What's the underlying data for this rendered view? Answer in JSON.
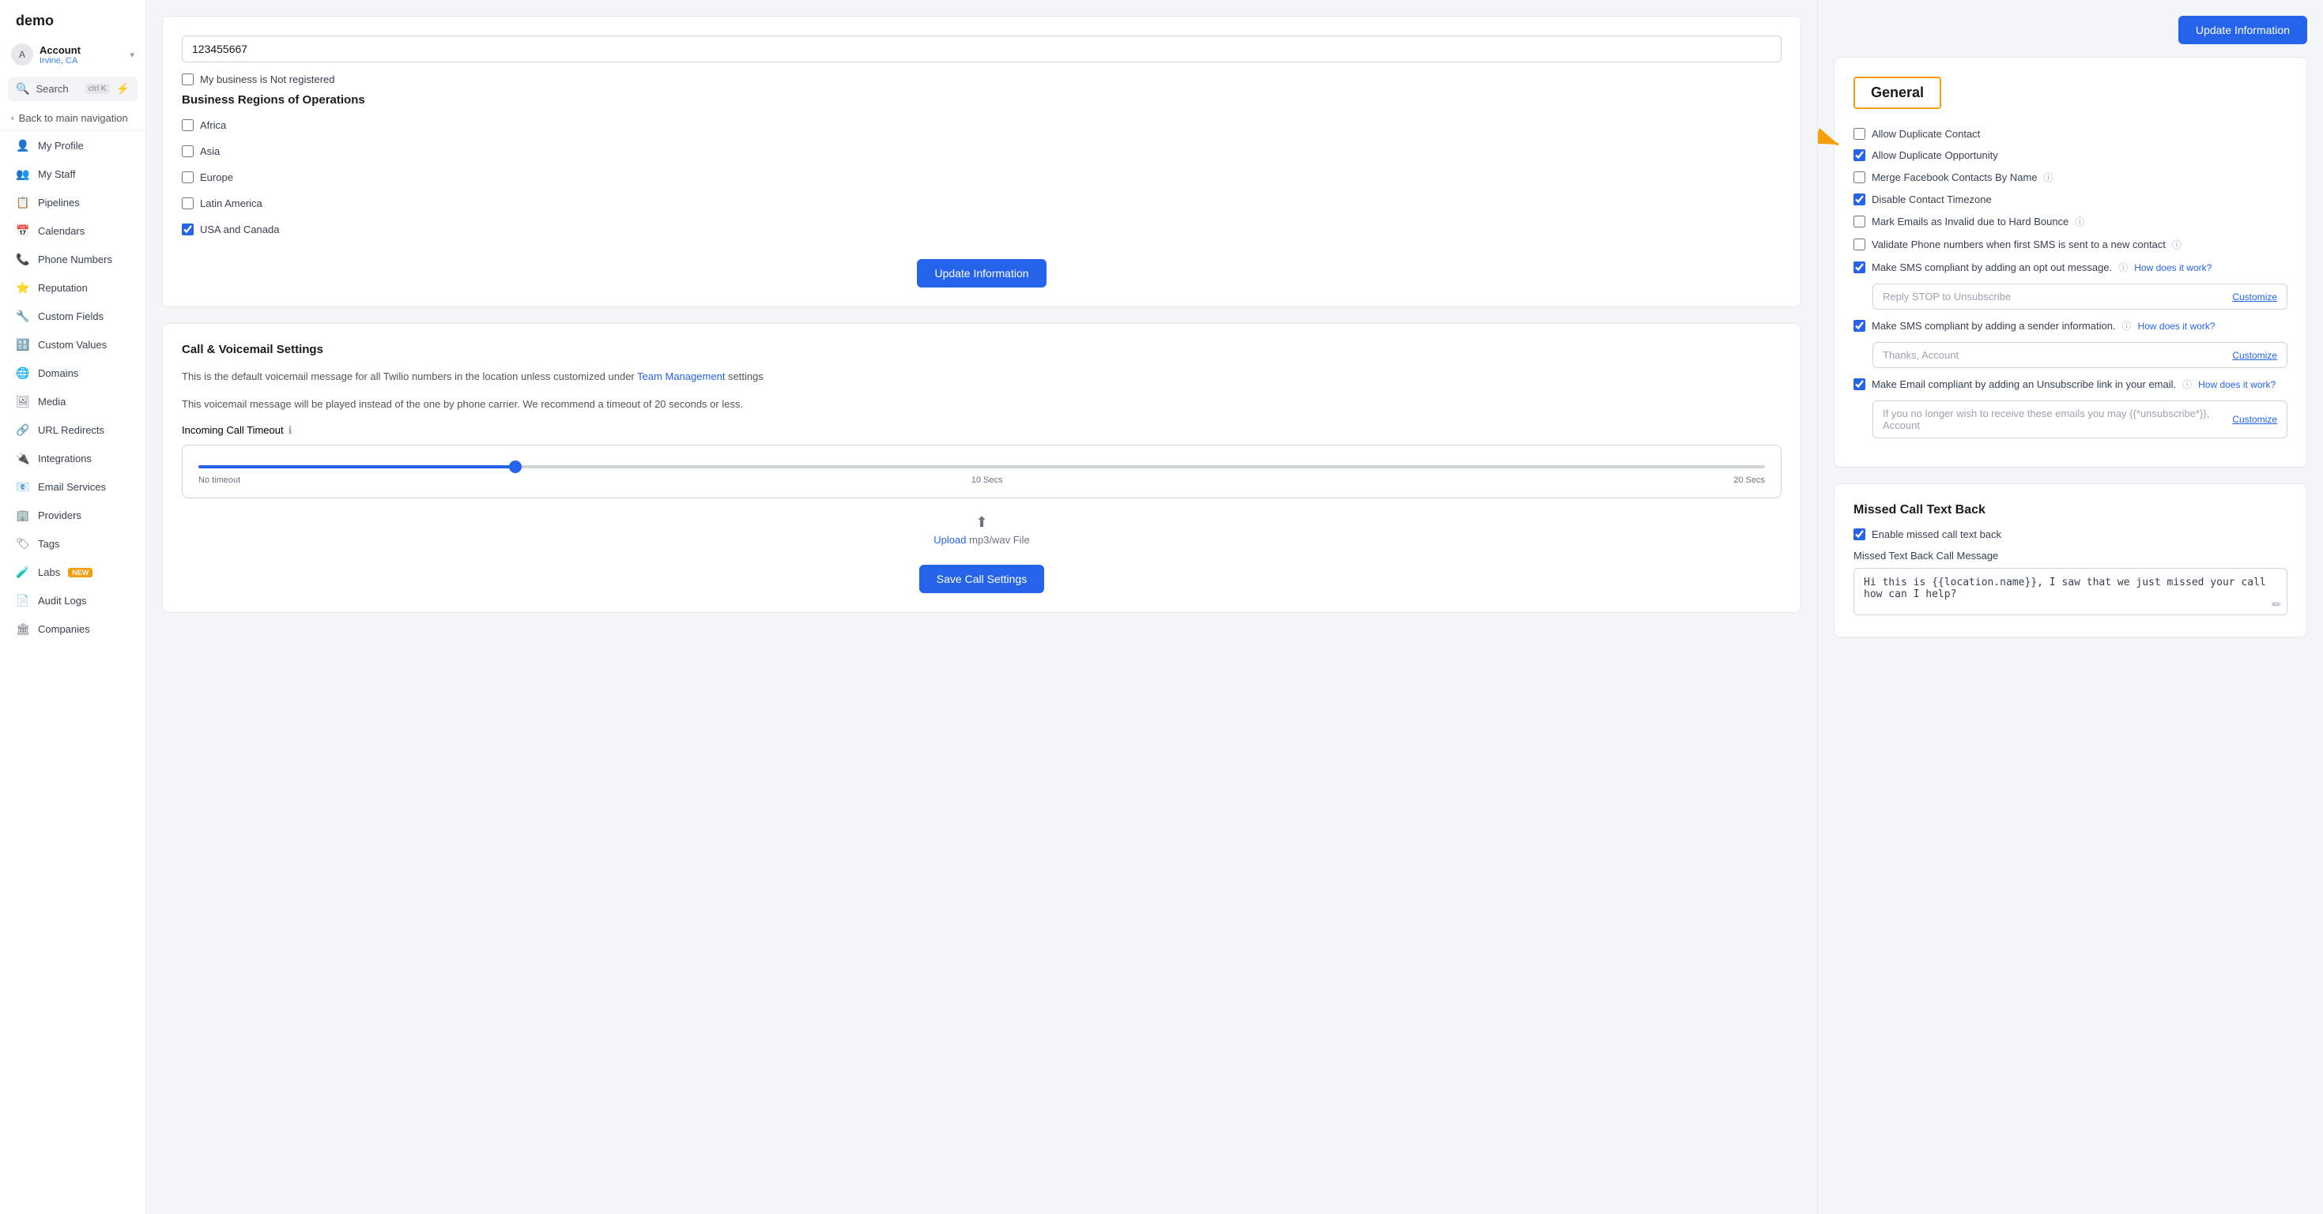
{
  "sidebar": {
    "logo": "demo",
    "account": {
      "name": "Account",
      "location": "Irvine, CA"
    },
    "search": {
      "label": "Search",
      "shortcut": "ctrl K"
    },
    "back_nav": "Back to main navigation",
    "items": [
      {
        "id": "my-profile",
        "label": "My Profile",
        "icon": "👤"
      },
      {
        "id": "my-staff",
        "label": "My Staff",
        "icon": "👥"
      },
      {
        "id": "pipelines",
        "label": "Pipelines",
        "icon": "📋"
      },
      {
        "id": "calendars",
        "label": "Calendars",
        "icon": "📅"
      },
      {
        "id": "phone-numbers",
        "label": "Phone Numbers",
        "icon": "📞"
      },
      {
        "id": "reputation",
        "label": "Reputation",
        "icon": "⭐"
      },
      {
        "id": "custom-fields",
        "label": "Custom Fields",
        "icon": "🔧"
      },
      {
        "id": "custom-values",
        "label": "Custom Values",
        "icon": "🔠"
      },
      {
        "id": "domains",
        "label": "Domains",
        "icon": "🌐"
      },
      {
        "id": "media",
        "label": "Media",
        "icon": "🖼"
      },
      {
        "id": "url-redirects",
        "label": "URL Redirects",
        "icon": "🔗"
      },
      {
        "id": "integrations",
        "label": "Integrations",
        "icon": "🔌"
      },
      {
        "id": "email-services",
        "label": "Email Services",
        "icon": "📧"
      },
      {
        "id": "providers",
        "label": "Providers",
        "icon": "🏢"
      },
      {
        "id": "tags",
        "label": "Tags",
        "icon": "🏷"
      },
      {
        "id": "labs",
        "label": "Labs",
        "icon": "🧪",
        "badge": "new"
      },
      {
        "id": "audit-logs",
        "label": "Audit Logs",
        "icon": "📄"
      },
      {
        "id": "companies",
        "label": "Companies",
        "icon": "🏛"
      }
    ]
  },
  "left_panel": {
    "business_number": "123455667",
    "not_registered_label": "My business is Not registered",
    "regions_title": "Business Regions of Operations",
    "regions": [
      {
        "label": "Africa",
        "checked": false
      },
      {
        "label": "Asia",
        "checked": false
      },
      {
        "label": "Europe",
        "checked": false
      },
      {
        "label": "Latin America",
        "checked": false
      },
      {
        "label": "USA and Canada",
        "checked": true
      }
    ],
    "update_btn": "Update Information",
    "call_voicemail": {
      "title": "Call & Voicemail Settings",
      "desc1": "This is the default voicemail message for all Twilio numbers in the location unless customized under",
      "link_text": "Team Management",
      "desc2": "settings",
      "desc3": "This voicemail message will be played instead of the one by phone carrier. We recommend a timeout of 20 seconds or less.",
      "timeout_label": "Incoming Call Timeout",
      "slider_labels": [
        "No timeout",
        "10 Secs",
        "20 Secs"
      ],
      "upload_label": "Upload mp3/wav File",
      "save_btn": "Save Call Settings"
    }
  },
  "right_panel": {
    "update_btn": "Update Information",
    "general_title": "General",
    "annotation_label": "General",
    "options": [
      {
        "id": "allow-duplicate-contact",
        "label": "Allow Duplicate Contact",
        "checked": false,
        "has_info": false,
        "has_link": false
      },
      {
        "id": "allow-duplicate-opportunity",
        "label": "Allow Duplicate Opportunity",
        "checked": true,
        "has_info": false,
        "has_link": false
      },
      {
        "id": "merge-facebook",
        "label": "Merge Facebook Contacts By Name",
        "checked": false,
        "has_info": true,
        "has_link": false
      },
      {
        "id": "disable-contact-tz",
        "label": "Disable Contact Timezone",
        "checked": true,
        "has_info": false,
        "has_link": false
      },
      {
        "id": "mark-emails-invalid",
        "label": "Mark Emails as Invalid due to Hard Bounce",
        "checked": false,
        "has_info": true,
        "has_link": false
      },
      {
        "id": "validate-phone",
        "label": "Validate Phone numbers when first SMS is sent to a new contact",
        "checked": false,
        "has_info": true,
        "has_link": false
      },
      {
        "id": "sms-compliant-opt-out",
        "label": "Make SMS compliant by adding an opt out message.",
        "checked": true,
        "has_info": true,
        "has_link": true,
        "link_text": "How does it work?",
        "sub_input": "Reply STOP to Unsubscribe",
        "customize_label": "Customize"
      },
      {
        "id": "sms-compliant-sender",
        "label": "Make SMS compliant by adding a sender information.",
        "checked": true,
        "has_info": true,
        "has_link": true,
        "link_text": "How does it work?",
        "sub_input": "Thanks, Account",
        "customize_label": "Customize"
      },
      {
        "id": "email-unsubscribe",
        "label": "Make Email compliant by adding an Unsubscribe link in your email.",
        "checked": true,
        "has_info": true,
        "has_link": true,
        "link_text": "How does it work?",
        "sub_input": "If you no longer wish to receive these emails you may {{*unsubscribe*}}, Account",
        "customize_label": "Customize"
      }
    ],
    "missed_call": {
      "title": "Missed Call Text Back",
      "enable_label": "Enable missed call text back",
      "enable_checked": true,
      "message_label": "Missed Text Back Call Message",
      "message_value": "Hi this is {{location.name}}, I saw that we just missed your call how can I help?"
    }
  }
}
